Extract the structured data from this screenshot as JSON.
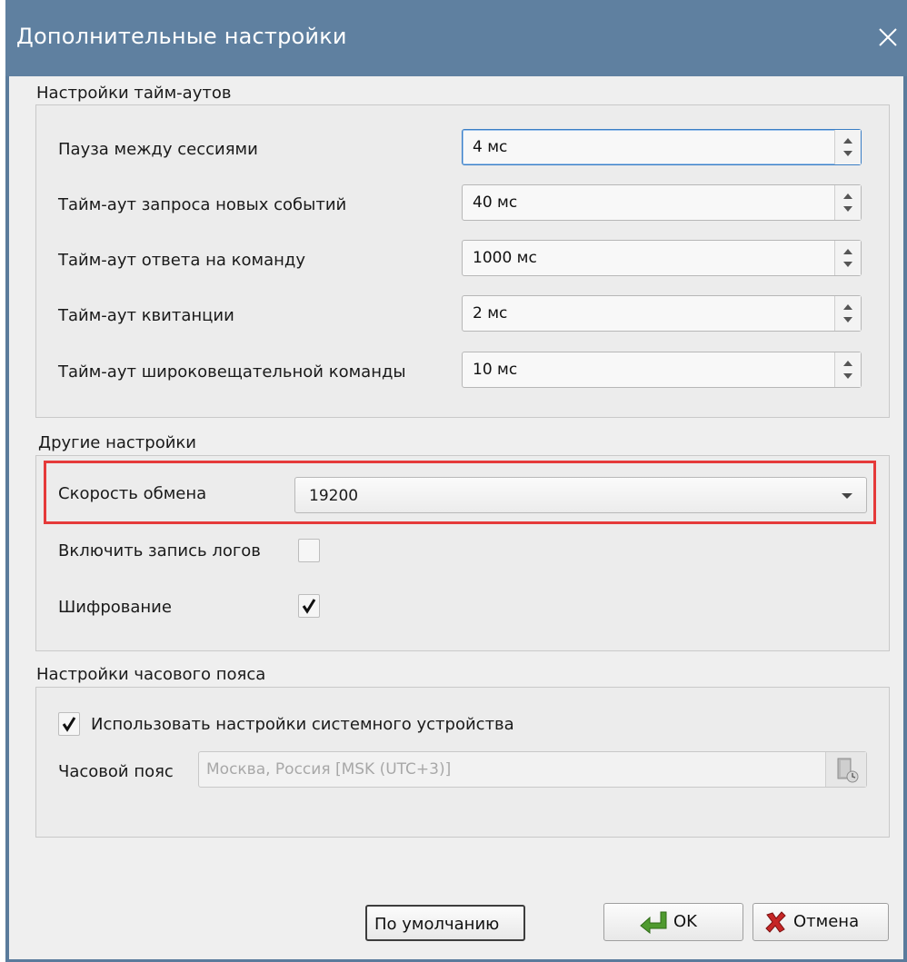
{
  "window": {
    "title": "Дополнительные настройки"
  },
  "timeouts": {
    "section_title": "Настройки тайм-аутов",
    "rows": [
      {
        "label": "Пауза между сессиями",
        "value": "4 мс"
      },
      {
        "label": "Тайм-аут запроса новых событий",
        "value": "40 мс"
      },
      {
        "label": "Тайм-аут ответа на команду",
        "value": "1000 мс"
      },
      {
        "label": "Тайм-аут квитанции",
        "value": "2 мс"
      },
      {
        "label": "Тайм-аут широковещательной команды",
        "value": "10 мс"
      }
    ]
  },
  "other": {
    "section_title": "Другие настройки",
    "speed_label": "Скорость обмена",
    "speed_value": "19200",
    "logs_label": "Включить запись логов",
    "logs_checked": false,
    "encryption_label": "Шифрование",
    "encryption_checked": true
  },
  "timezone": {
    "section_title": "Настройки часового пояса",
    "use_system_label": "Использовать настройки системного устройства",
    "use_system_checked": true,
    "tz_label": "Часовой пояс",
    "tz_value": "Москва, Россия [MSK (UTC+3)]"
  },
  "buttons": {
    "defaults": "По умолчанию",
    "ok": "OK",
    "cancel": "Отмена"
  },
  "colors": {
    "titlebar": "#5f80a0",
    "highlight": "#e53a3a",
    "focus": "#3a7ec5"
  }
}
